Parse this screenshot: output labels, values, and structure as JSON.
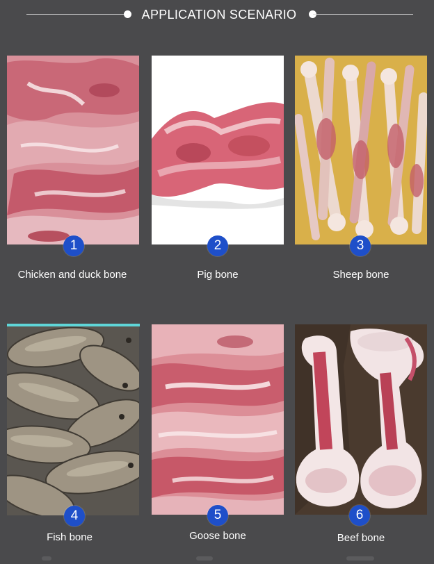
{
  "header": {
    "title": "APPLICATION SCENARIO"
  },
  "items": [
    {
      "number": "1",
      "label": "Chicken and duck bone"
    },
    {
      "number": "2",
      "label": "Pig bone"
    },
    {
      "number": "3",
      "label": "Sheep bone"
    },
    {
      "number": "4",
      "label": "Fish bone"
    },
    {
      "number": "5",
      "label": "Goose bone"
    },
    {
      "number": "6",
      "label": "Beef bone"
    }
  ],
  "colors": {
    "background": "#4a4a4c",
    "badge": "#1e4fc9",
    "accent": "#5fd6d8"
  }
}
